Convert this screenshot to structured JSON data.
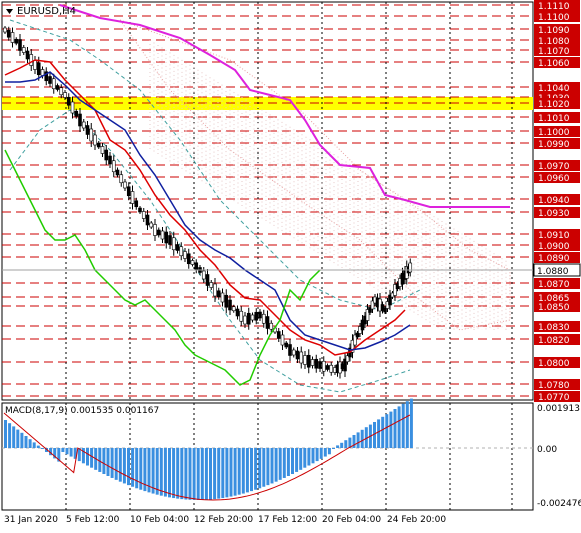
{
  "window": {
    "title": "EURUSD,H4",
    "menu_icon": "triangle-down-icon"
  },
  "price_axis": {
    "labels": [
      "1.1110",
      "1.1100",
      "1.1090",
      "1.1080",
      "1.1070",
      "1.1060",
      "1.1040",
      "1.1030",
      "1.1020",
      "1.1010",
      "1.1000",
      "1.0990",
      "1.0970",
      "1.0960",
      "1.0940",
      "1.0930",
      "1.0910",
      "1.0900",
      "1.0890",
      "1.0870",
      "1.0865",
      "1.0850",
      "1.0830",
      "1.0820",
      "1.0800",
      "1.0780",
      "1.0770"
    ],
    "current_price": "1.0880",
    "current_price_color": "#ffffff",
    "label_color": "#cc0000"
  },
  "macd": {
    "label": "MACD(8,17,9) 0.001535 0.001167",
    "axis_labels": [
      "0.001913",
      "0.00",
      "-0.002476"
    ],
    "histogram_color": "#3a8fe0",
    "signal_color": "#cc0000"
  },
  "time_axis": {
    "labels": [
      "31 Jan 2020",
      "5 Feb 12:00",
      "10 Feb 04:00",
      "12 Feb 20:00",
      "17 Feb 12:00",
      "20 Feb 04:00",
      "24 Feb 20:00"
    ]
  },
  "colors": {
    "ma_red": "#dd0000",
    "ma_blue": "#1020a0",
    "ma_green": "#22cc00",
    "ma_magenta": "#dd22dd",
    "zone_yellow": "#ffff00",
    "level_line": "#cc0000",
    "grid": "#000000"
  }
}
